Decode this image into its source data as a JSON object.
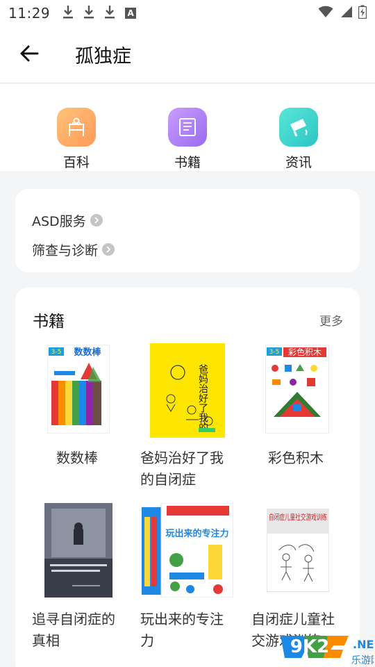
{
  "status_bar": {
    "time": "11:29",
    "a_badge": "A"
  },
  "header": {
    "title": "孤独症"
  },
  "categories": [
    {
      "label": "百科",
      "icon": "encyclopedia-icon",
      "color": "#ff9a5a"
    },
    {
      "label": "书籍",
      "icon": "book-icon",
      "color": "#9b6bf0"
    },
    {
      "label": "资讯",
      "icon": "news-icon",
      "color": "#2bc5c4"
    }
  ],
  "links": [
    {
      "label": "ASD服务"
    },
    {
      "label": "筛查与诊断"
    }
  ],
  "books_section": {
    "title": "书籍",
    "more": "更多",
    "books": [
      {
        "title": "数数棒",
        "cover_text": "数数棒",
        "cover_badge": "3-5"
      },
      {
        "title": "爸妈治好了我的自闭症",
        "cover_text": "爸妈治好了我的"
      },
      {
        "title": "彩色积木",
        "cover_text": "彩色积木",
        "cover_badge": "3-5"
      },
      {
        "title": "追寻自闭症的真相",
        "cover_text": ""
      },
      {
        "title": "玩出来的专注力",
        "cover_text": "玩出来的专注力"
      },
      {
        "title": "自闭症儿童社交游戏训练",
        "cover_text": "自闭症儿童社交游戏训练"
      }
    ]
  },
  "watermark": {
    "text": "9K2",
    "sub": "乐游网",
    "net": ".NET"
  },
  "colors": {
    "accent_orange": "#ff9a5a",
    "accent_purple": "#9b6bf0",
    "accent_teal": "#2bc5c4"
  }
}
